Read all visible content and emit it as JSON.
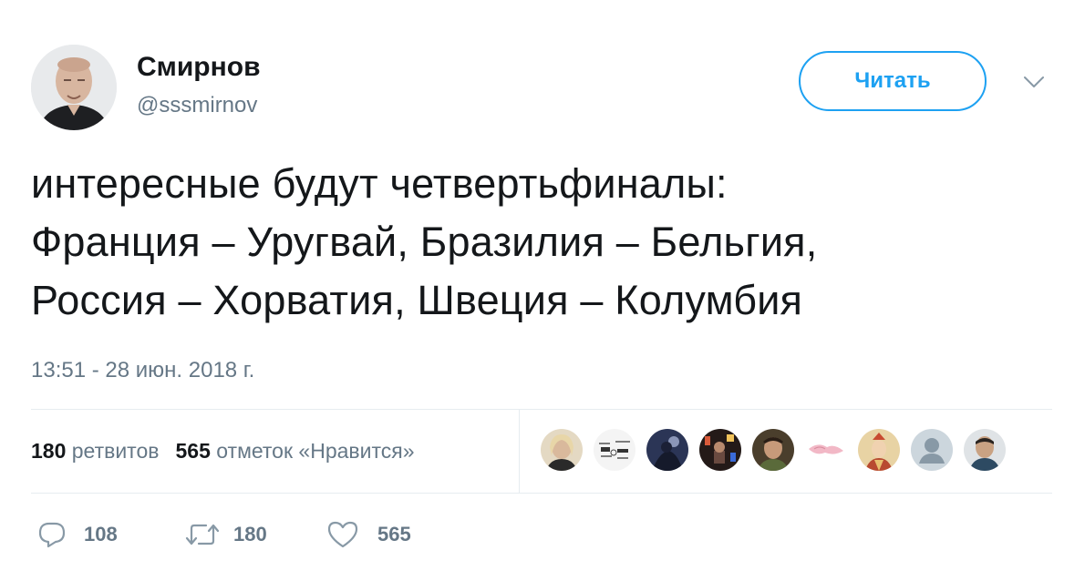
{
  "header": {
    "display_name": "Смирнов",
    "handle": "@sssmirnov",
    "follow_label": "Читать"
  },
  "tweet": {
    "lines": [
      "интересные будут четвертьфиналы:",
      "Франция – Уругвай, Бразилия – Бельгия,",
      "Россия – Хорватия, Швеция – Колумбия"
    ],
    "timestamp": "13:51 - 28 июн. 2018 г."
  },
  "stats": {
    "retweets_count": "180",
    "retweets_label": "ретвитов",
    "likes_count": "565",
    "likes_label": "отметок «Нравится»"
  },
  "likers": [
    {
      "name": "liker-1",
      "color": "#c9b89a"
    },
    {
      "name": "liker-2",
      "color": "#f2f2f2"
    },
    {
      "name": "liker-3",
      "color": "#2e3a5c"
    },
    {
      "name": "liker-4",
      "color": "#3a2a26"
    },
    {
      "name": "liker-5",
      "color": "#5a4a32"
    },
    {
      "name": "liker-6",
      "color": "#f6e6ea"
    },
    {
      "name": "liker-7",
      "color": "#d9b77a"
    },
    {
      "name": "liker-8",
      "color": "#ccd6dd"
    },
    {
      "name": "liker-9",
      "color": "#8a9aa4"
    }
  ],
  "actions": {
    "reply_icon": "reply-icon",
    "reply_count": "108",
    "retweet_icon": "retweet-icon",
    "retweet_count": "180",
    "like_icon": "heart-icon",
    "like_count": "565"
  },
  "colors": {
    "accent": "#1da1f2",
    "secondary_text": "#657786",
    "primary_text": "#14171a",
    "divider": "#e6ecf0"
  }
}
